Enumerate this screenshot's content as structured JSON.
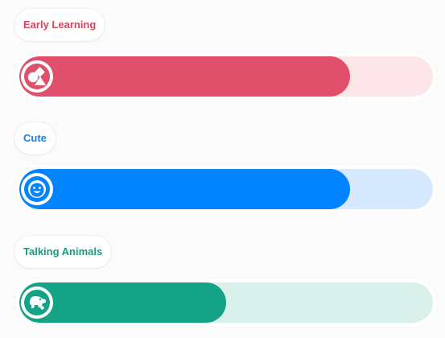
{
  "categories": [
    {
      "label": "Early Learning",
      "progress_percent": 80,
      "icon": "shapes-icon",
      "fill_color": "#e0506a",
      "track_color": "#fde6ea",
      "label_color": "#d9445f"
    },
    {
      "label": "Cute",
      "progress_percent": 80,
      "icon": "smiley-face-icon",
      "fill_color": "#0384ff",
      "track_color": "#d6e9fe",
      "label_color": "#1d7fe0"
    },
    {
      "label": "Talking Animals",
      "progress_percent": 50,
      "icon": "dog-icon",
      "fill_color": "#14a387",
      "track_color": "#daf0eb",
      "label_color": "#1a9a7e"
    }
  ]
}
